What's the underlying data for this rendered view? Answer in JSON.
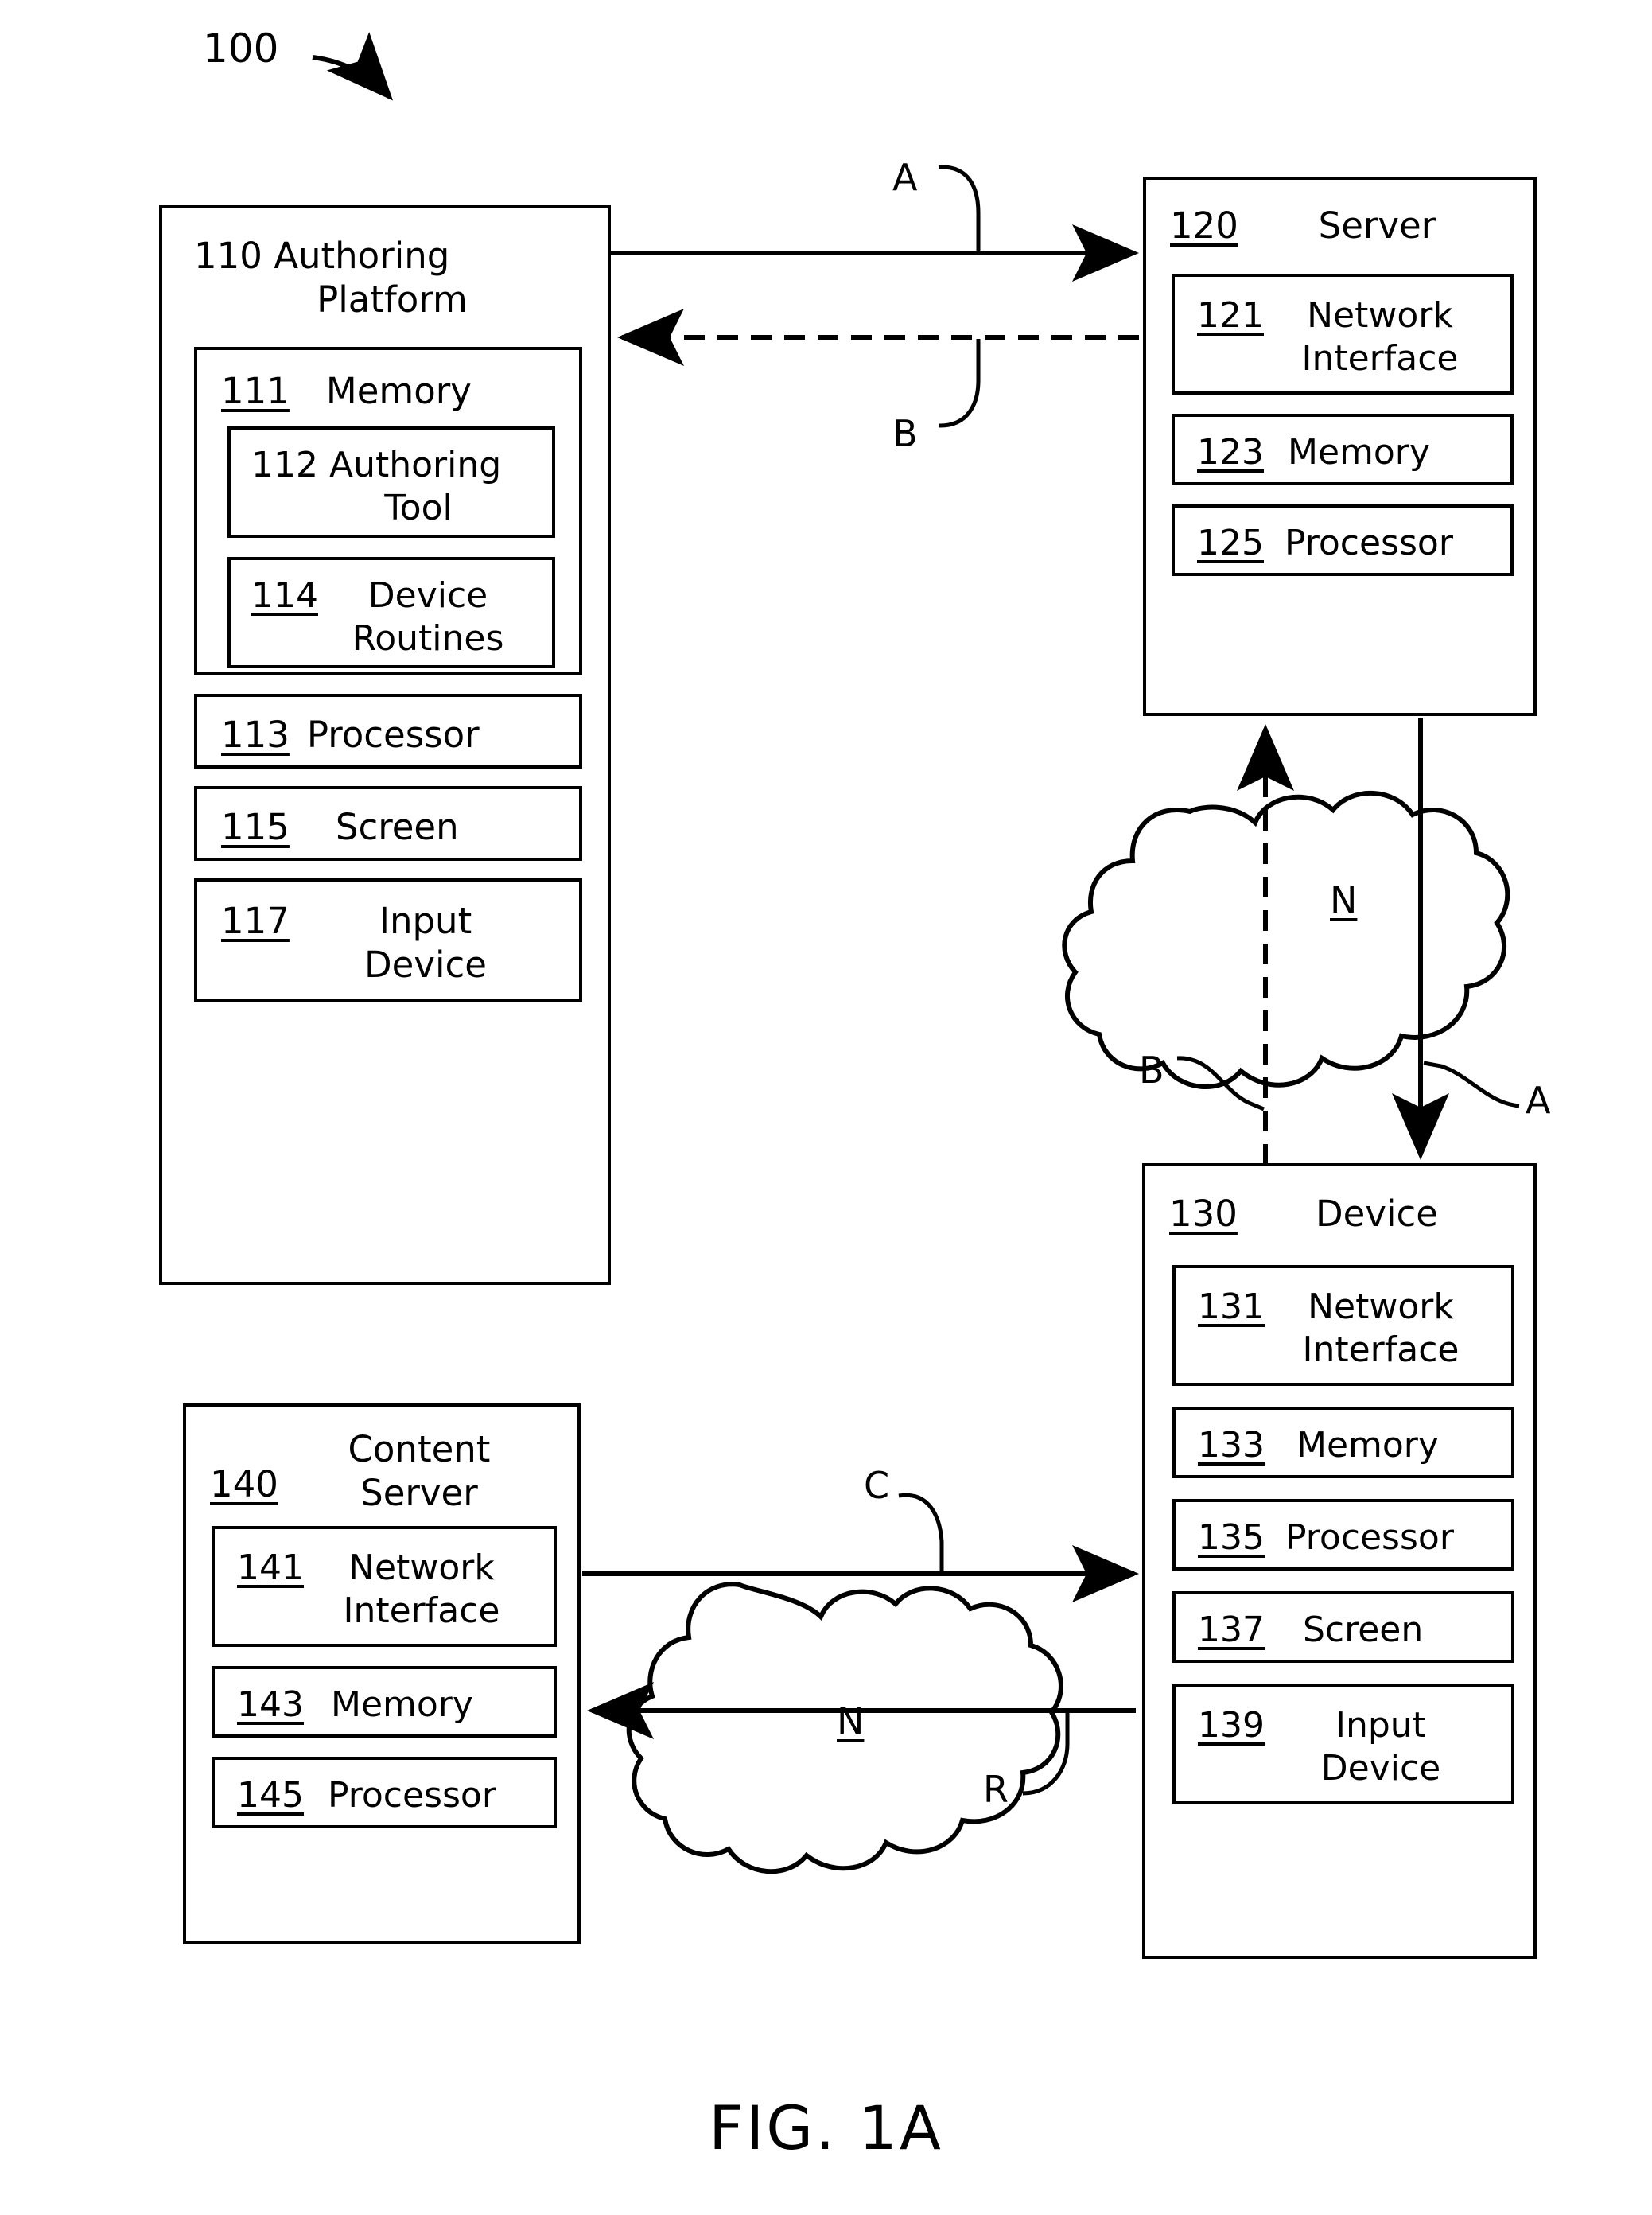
{
  "figure": {
    "number_label": "100",
    "caption": "FIG. 1A"
  },
  "blocks": {
    "authoring_platform": {
      "ref": "110",
      "label": "Authoring Platform",
      "label_line1": "110 Authoring",
      "label_line2": "Platform",
      "children": {
        "memory": {
          "ref": "111",
          "label": "Memory",
          "children": {
            "authoring_tool": {
              "ref": "112",
              "label_line1": "112 Authoring",
              "label_line2": "Tool"
            },
            "device_routines": {
              "ref": "114",
              "label_line1": "Device",
              "label_line2": "Routines"
            }
          }
        },
        "processor": {
          "ref": "113",
          "label": "Processor"
        },
        "screen": {
          "ref": "115",
          "label": "Screen"
        },
        "input_device": {
          "ref": "117",
          "label_line1": "Input",
          "label_line2": "Device"
        }
      }
    },
    "server": {
      "ref": "120",
      "label": "Server",
      "children": {
        "network_interface": {
          "ref": "121",
          "label_line1": "Network",
          "label_line2": "Interface"
        },
        "memory": {
          "ref": "123",
          "label": "Memory"
        },
        "processor": {
          "ref": "125",
          "label": "Processor"
        }
      }
    },
    "device": {
      "ref": "130",
      "label": "Device",
      "children": {
        "network_interface": {
          "ref": "131",
          "label_line1": "Network",
          "label_line2": "Interface"
        },
        "memory": {
          "ref": "133",
          "label": "Memory"
        },
        "processor": {
          "ref": "135",
          "label": "Processor"
        },
        "screen": {
          "ref": "137",
          "label": "Screen"
        },
        "input_device": {
          "ref": "139",
          "label_line1": "Input",
          "label_line2": "Device"
        }
      }
    },
    "content_server": {
      "ref": "140",
      "label_line1": "Content",
      "label_line2": "Server",
      "children": {
        "network_interface": {
          "ref": "141",
          "label_line1": "Network",
          "label_line2": "Interface"
        },
        "memory": {
          "ref": "143",
          "label": "Memory"
        },
        "processor": {
          "ref": "145",
          "label": "Processor"
        }
      }
    }
  },
  "clouds": {
    "upper_network": {
      "label": "N"
    },
    "lower_network": {
      "label": "N"
    }
  },
  "flow_markers": {
    "platform_to_server_A": "A",
    "server_to_platform_B": "B",
    "server_to_device_A": "A",
    "device_to_server_B": "B",
    "content_to_device_C": "C",
    "device_to_content_R": "R"
  }
}
